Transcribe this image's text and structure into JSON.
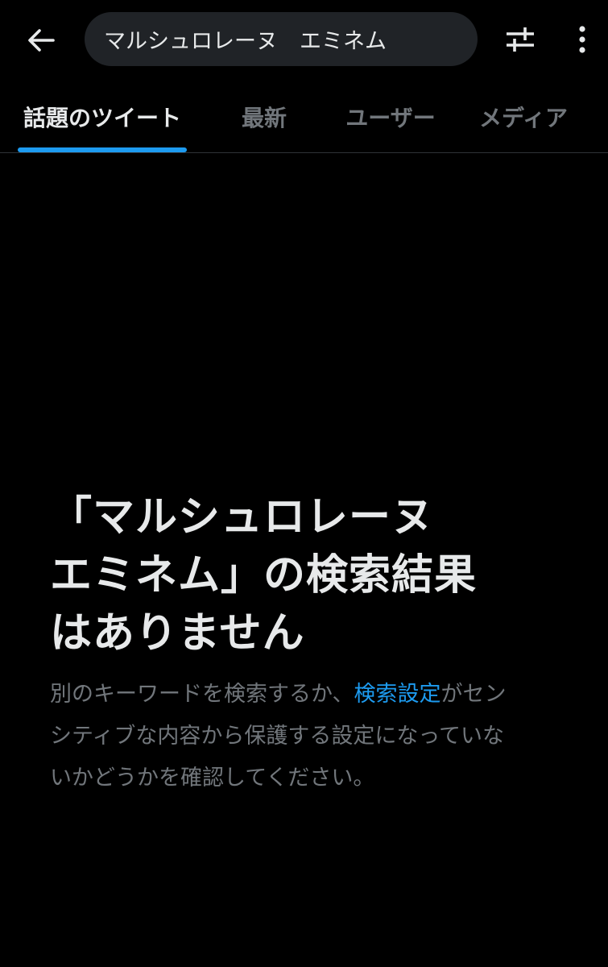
{
  "search": {
    "query": "マルシュロレーヌ　エミネム"
  },
  "icons": {
    "back": "arrow-left-icon",
    "filter": "sliders-icon",
    "more": "vertical-ellipsis-icon"
  },
  "tabs": [
    {
      "label": "話題のツイート",
      "active": true
    },
    {
      "label": "最新",
      "active": false
    },
    {
      "label": "ユーザー",
      "active": false
    },
    {
      "label": "メディア",
      "active": false
    }
  ],
  "empty_state": {
    "title_line1": "「マルシュロレーヌ",
    "title_line2": "エミネム」の検索結果",
    "title_line3": "はありません",
    "body_before_link": "別のキーワードを検索するか、",
    "link_label": "検索設定",
    "body_line1_rest": "がセン",
    "body_line2": "シティブな内容から保護する設定になっていな",
    "body_line3": "いかどうかを確認してください。"
  },
  "colors": {
    "background": "#000000",
    "text_primary": "#e7e9ea",
    "text_secondary": "#71767b",
    "accent": "#1d9bf0",
    "search_bg": "#202327"
  }
}
